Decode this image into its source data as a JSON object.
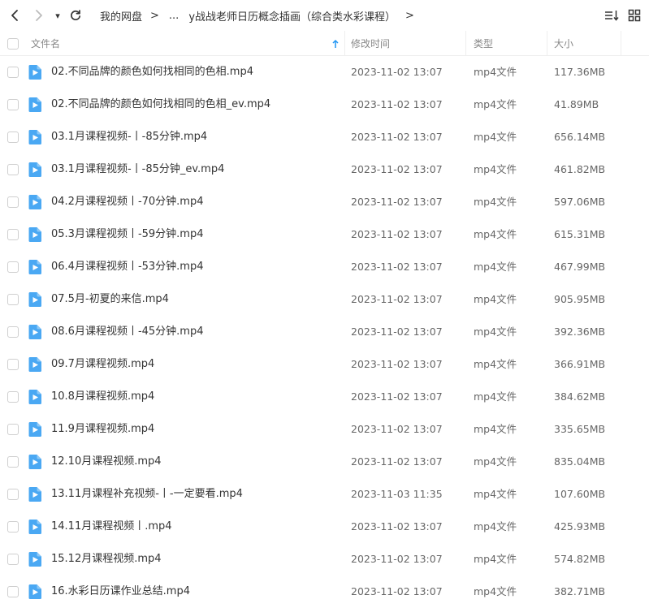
{
  "nav": {
    "history_glyph": "▾",
    "breadcrumb": {
      "root": "我的网盘",
      "ellipsis": "...",
      "current": "y战战老师日历概念插画（综合类水彩课程）"
    }
  },
  "columns": {
    "name": "文件名",
    "modified": "修改时间",
    "type": "类型",
    "size": "大小"
  },
  "colors": {
    "accent": "#2196f3",
    "file_icon": "#4aa8f3"
  },
  "files": [
    {
      "name": "02.不同品牌的颜色如何找相同的色相.mp4",
      "modified": "2023-11-02 13:07",
      "type": "mp4文件",
      "size": "117.36MB"
    },
    {
      "name": "02.不同品牌的颜色如何找相同的色相_ev.mp4",
      "modified": "2023-11-02 13:07",
      "type": "mp4文件",
      "size": "41.89MB"
    },
    {
      "name": "03.1月课程视频-丨-85分钟.mp4",
      "modified": "2023-11-02 13:07",
      "type": "mp4文件",
      "size": "656.14MB"
    },
    {
      "name": "03.1月课程视频-丨-85分钟_ev.mp4",
      "modified": "2023-11-02 13:07",
      "type": "mp4文件",
      "size": "461.82MB"
    },
    {
      "name": "04.2月课程视频丨-70分钟.mp4",
      "modified": "2023-11-02 13:07",
      "type": "mp4文件",
      "size": "597.06MB"
    },
    {
      "name": "05.3月课程视频丨-59分钟.mp4",
      "modified": "2023-11-02 13:07",
      "type": "mp4文件",
      "size": "615.31MB"
    },
    {
      "name": "06.4月课程视频丨-53分钟.mp4",
      "modified": "2023-11-02 13:07",
      "type": "mp4文件",
      "size": "467.99MB"
    },
    {
      "name": "07.5月-初夏的来信.mp4",
      "modified": "2023-11-02 13:07",
      "type": "mp4文件",
      "size": "905.95MB"
    },
    {
      "name": "08.6月课程视频丨-45分钟.mp4",
      "modified": "2023-11-02 13:07",
      "type": "mp4文件",
      "size": "392.36MB"
    },
    {
      "name": "09.7月课程视频.mp4",
      "modified": "2023-11-02 13:07",
      "type": "mp4文件",
      "size": "366.91MB"
    },
    {
      "name": "10.8月课程视频.mp4",
      "modified": "2023-11-02 13:07",
      "type": "mp4文件",
      "size": "384.62MB"
    },
    {
      "name": "11.9月课程视频.mp4",
      "modified": "2023-11-02 13:07",
      "type": "mp4文件",
      "size": "335.65MB"
    },
    {
      "name": "12.10月课程视频.mp4",
      "modified": "2023-11-02 13:07",
      "type": "mp4文件",
      "size": "835.04MB"
    },
    {
      "name": "13.11月课程补充视频-丨-一定要看.mp4",
      "modified": "2023-11-03 11:35",
      "type": "mp4文件",
      "size": "107.60MB"
    },
    {
      "name": "14.11月课程视频丨.mp4",
      "modified": "2023-11-02 13:07",
      "type": "mp4文件",
      "size": "425.93MB"
    },
    {
      "name": "15.12月课程视频.mp4",
      "modified": "2023-11-02 13:07",
      "type": "mp4文件",
      "size": "574.82MB"
    },
    {
      "name": "16.水彩日历课作业总结.mp4",
      "modified": "2023-11-02 13:07",
      "type": "mp4文件",
      "size": "382.71MB"
    }
  ]
}
